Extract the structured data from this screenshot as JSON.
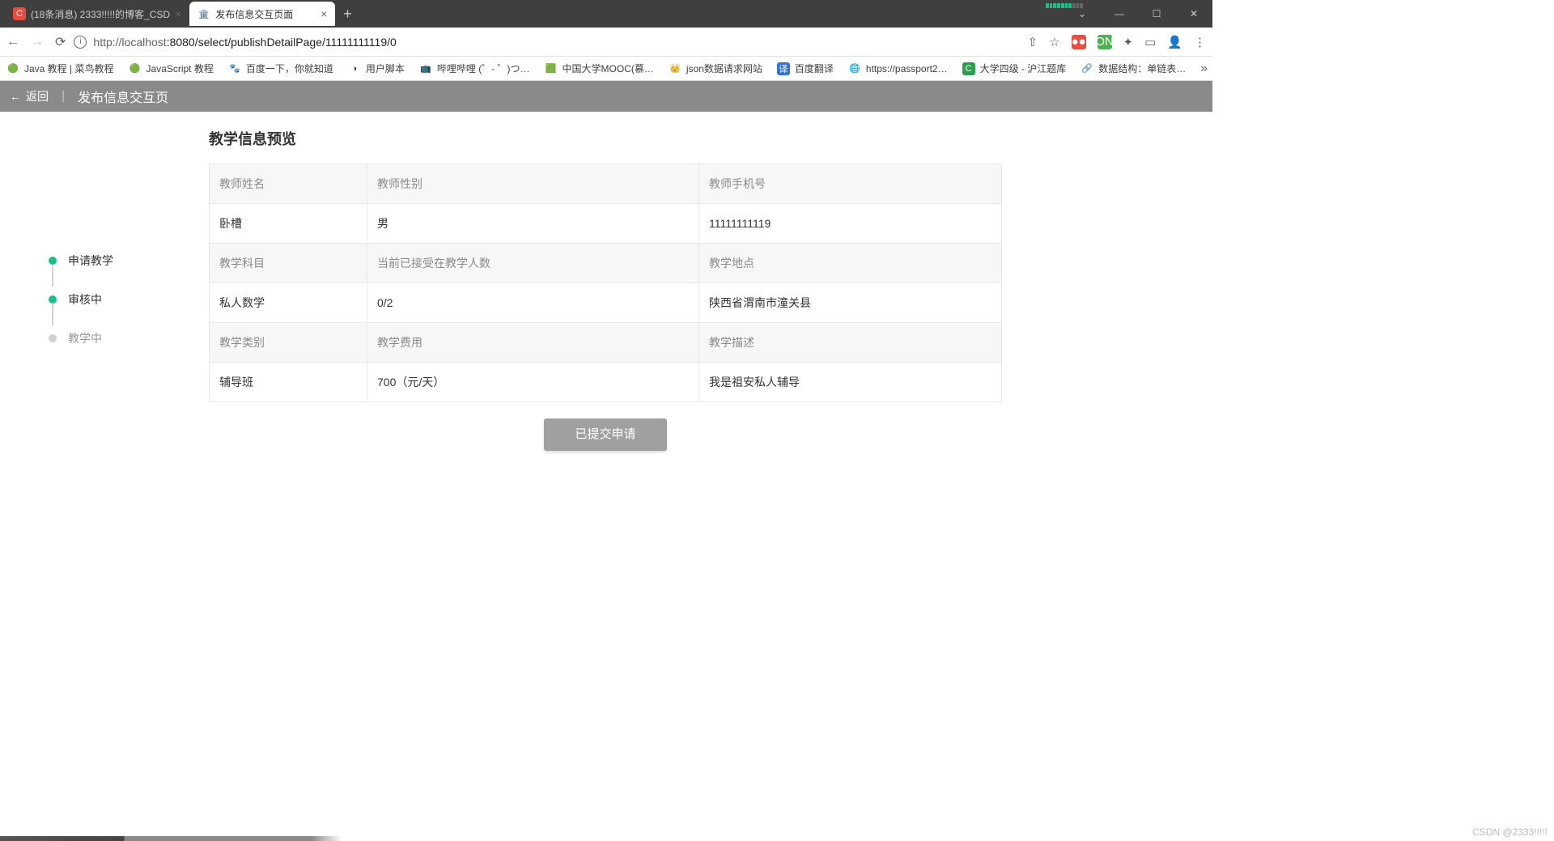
{
  "browser": {
    "tabs": [
      {
        "title": "(18条消息) 2333!!!!!的博客_CSD",
        "favicon_bg": "#e84d3d",
        "favicon_text": "C",
        "active": false
      },
      {
        "title": "发布信息交互页面",
        "favicon_bg": "#fff",
        "favicon_text": "🏛️",
        "active": true
      }
    ],
    "url_host": "http://localhost",
    "url_port": ":8080",
    "url_path": "/select/publishDetailPage/11111111119/0",
    "bookmarks": [
      {
        "label": "Java 教程 | 菜鸟教程",
        "ico": "🟢"
      },
      {
        "label": "JavaScript 教程",
        "ico": "🟢"
      },
      {
        "label": "百度一下，你就知道",
        "ico": "🐾"
      },
      {
        "label": "用户脚本",
        "ico": "◑"
      },
      {
        "label": "哔哩哔哩 (゜- ゜)つ…",
        "ico": "📺"
      },
      {
        "label": "中国大学MOOC(慕…",
        "ico": "🟩"
      },
      {
        "label": "json数据请求网站",
        "ico": "👑"
      },
      {
        "label": "百度翻译",
        "ico": "译"
      },
      {
        "label": "https://passport2…",
        "ico": "🌐"
      },
      {
        "label": "大学四级 - 沪江题库",
        "ico": "C"
      },
      {
        "label": "数据结构：单链表…",
        "ico": "🔗"
      }
    ],
    "window": {
      "min": "—",
      "max": "☐",
      "close": "✕",
      "dropdown": "⌄"
    }
  },
  "header": {
    "back": "返回",
    "title": "发布信息交互页"
  },
  "steps": [
    {
      "label": "申请教学",
      "state": "done"
    },
    {
      "label": "审核中",
      "state": "done"
    },
    {
      "label": "教学中",
      "state": "pending"
    }
  ],
  "section_title": "教学信息预览",
  "table": {
    "r1h": [
      "教师姓名",
      "教师性别",
      "教师手机号"
    ],
    "r1v": [
      "卧槽",
      "男",
      "11111111119"
    ],
    "r2h": [
      "教学科目",
      "当前已接受在教学人数",
      "教学地点"
    ],
    "r2v": [
      "私人数学",
      "0/2",
      "陕西省渭南市潼关县"
    ],
    "r3h": [
      "教学类别",
      "教学费用",
      "教学描述"
    ],
    "r3v": [
      "辅导班",
      "700（元/天）",
      "我是祖安私人辅导"
    ]
  },
  "submit_label": "已提交申请",
  "watermark": "CSDN @2333!!!!!"
}
